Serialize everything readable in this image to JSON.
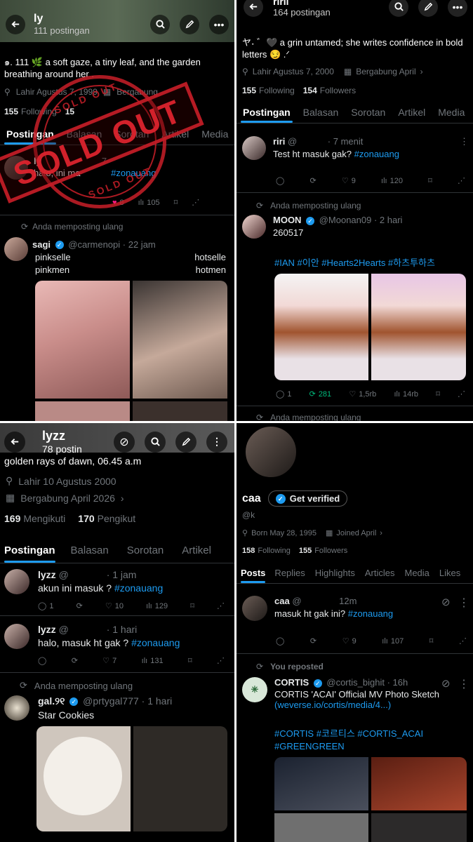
{
  "p1": {
    "name": "ly",
    "posts": "111 postingan",
    "bio": "๑. 111 🌿 a soft gaze, a tiny leaf, and the garden breathing around her .",
    "birth": "Lahir Agustus 7, 1999",
    "joined": "Bergabung",
    "following_count": "155",
    "following_label": "Following",
    "followers_count": "15",
    "tabs": [
      "Postingan",
      "Balasan",
      "Sorotan",
      "Artikel",
      "Media"
    ],
    "post1": {
      "name": "ly",
      "time": "7",
      "text": "halo, ini ma",
      "hashtag": "#zonauang",
      "likes": "8",
      "views": "105"
    },
    "repost_label": "Anda memposting ulang",
    "post2": {
      "name": "sagi",
      "handle": "@carmenopi",
      "time": "· 22 jam",
      "l1": "pinkselle",
      "r1": "hotselle",
      "l2": "pinkmen",
      "r2": "hotmen"
    },
    "stamp": {
      "band": "SOLD OUT",
      "ring_top": "SOLD OUT",
      "ring_bottom": "SOLD OUT"
    }
  },
  "p2": {
    "name": "ririi",
    "posts": "164 postingan",
    "bio": "ヤ˖ ゛🖤 a grin untamed; she writes confidence in bold letters 😏 .ᐟ",
    "birth": "Lahir Agustus 7, 2000",
    "joined": "Bergabung April",
    "following_count": "155",
    "following_label": "Following",
    "followers_count": "154",
    "followers_label": "Followers",
    "tabs": [
      "Postingan",
      "Balasan",
      "Sorotan",
      "Artikel",
      "Media"
    ],
    "post1": {
      "name": "riri",
      "handle": "@",
      "time": "· 7 menit",
      "text": "Test ht masuk gak?",
      "hashtag": "#zonauang",
      "likes": "9",
      "views": "120"
    },
    "repost_label": "Anda memposting ulang",
    "post2": {
      "name": "MOON",
      "handle": "@Moonan09",
      "time": "· 2 hari",
      "text": "260517",
      "hashtags": "#IAN #이안 #Hearts2Hearts #하츠투하츠",
      "replies": "1",
      "reposts": "281",
      "likes": "1,5rb",
      "views": "14rb"
    },
    "bottom_repost_label": "Anda memposting ulang"
  },
  "p3": {
    "name": "lyzz",
    "posts": "78 postin",
    "bio": "golden rays of dawn, 06.45 a.m",
    "birth": "Lahir 10 Agustus 2000",
    "joined": "Bergabung April 2026",
    "following_count": "169",
    "following_label": "Mengikuti",
    "followers_count": "170",
    "followers_label": "Pengikut",
    "tabs": [
      "Postingan",
      "Balasan",
      "Sorotan",
      "Artikel"
    ],
    "post1": {
      "name": "lyzz",
      "handle": "@",
      "time": "· 1 jam",
      "text": "akun ini masuk ?",
      "hashtag": "#zonauang",
      "replies": "1",
      "likes": "10",
      "views": "129"
    },
    "post2": {
      "name": "lyzz",
      "handle": "@",
      "time": "· 1 hari",
      "text": "halo, masuk ht gak ?",
      "hashtag": "#zonauang",
      "likes": "7",
      "views": "131"
    },
    "repost_label": "Anda memposting ulang",
    "post3": {
      "name": "gal.୨୧",
      "handle": "@prtygal777",
      "time": "· 1 hari",
      "text": "Star Cookies"
    }
  },
  "p4": {
    "name": "caa",
    "verify_label": "Get verified",
    "handle": "@k",
    "birth": "Born May 28, 1995",
    "joined": "Joined April",
    "following_count": "158",
    "following_label": "Following",
    "followers_count": "155",
    "followers_label": "Followers",
    "tabs": [
      "Posts",
      "Replies",
      "Highlights",
      "Articles",
      "Media",
      "Likes"
    ],
    "post1": {
      "name": "caa",
      "handle": "@",
      "time": "12m",
      "text": "masuk ht gak ini?",
      "hashtag": "#zonauang",
      "likes": "9",
      "views": "107"
    },
    "repost_label": "You reposted",
    "post2": {
      "name": "CORTIS",
      "handle": "@cortis_bighit",
      "time": "· 16h",
      "text": "CORTIS 'ACAI' Official MV Photo Sketch",
      "link": "(weverse.io/cortis/media/4...)",
      "hashtags1": "#CORTIS #코르티스 #CORTIS_ACAI",
      "hashtags2": "#GREENGREEN"
    }
  }
}
